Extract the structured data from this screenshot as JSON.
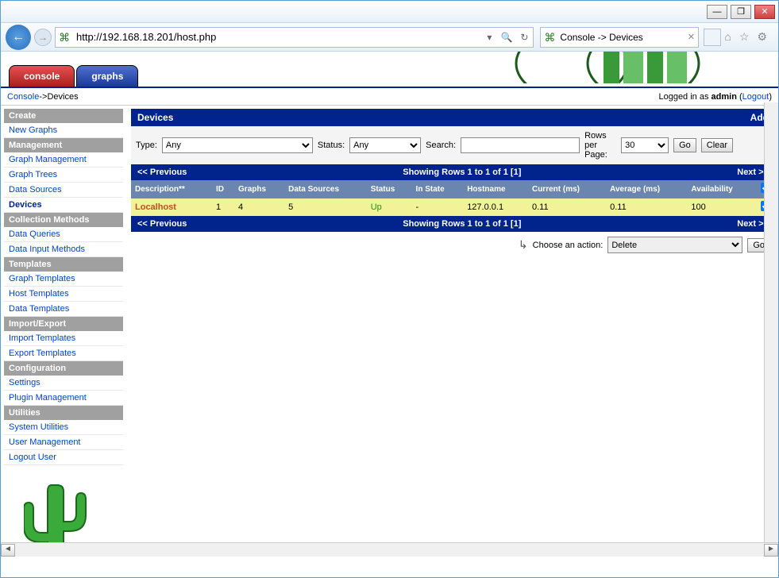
{
  "window": {
    "minimize": "—",
    "maximize": "❐",
    "close": "✕"
  },
  "browser": {
    "url": "http://192.168.18.201/host.php",
    "tab_title": "Console -> Devices",
    "search": "🔍",
    "refresh": "↻",
    "dropdown": "▾",
    "home": "⌂",
    "star": "☆",
    "gear": "⚙"
  },
  "tabs": {
    "console": "console",
    "graphs": "graphs"
  },
  "breadcrumb": {
    "console": "Console",
    "sep": " -> ",
    "page": "Devices",
    "logged": "Logged in as ",
    "user": "admin",
    "logout": "Logout"
  },
  "sidebar": {
    "sections": [
      {
        "title": "Create",
        "items": [
          "New Graphs"
        ]
      },
      {
        "title": "Management",
        "items": [
          "Graph Management",
          "Graph Trees",
          "Data Sources",
          "Devices"
        ]
      },
      {
        "title": "Collection Methods",
        "items": [
          "Data Queries",
          "Data Input Methods"
        ]
      },
      {
        "title": "Templates",
        "items": [
          "Graph Templates",
          "Host Templates",
          "Data Templates"
        ]
      },
      {
        "title": "Import/Export",
        "items": [
          "Import Templates",
          "Export Templates"
        ]
      },
      {
        "title": "Configuration",
        "items": [
          "Settings",
          "Plugin Management"
        ]
      },
      {
        "title": "Utilities",
        "items": [
          "System Utilities",
          "User Management",
          "Logout User"
        ]
      }
    ],
    "active": "Devices"
  },
  "main": {
    "title": "Devices",
    "add": "Add",
    "filter": {
      "type_label": "Type:",
      "type_val": "Any",
      "status_label": "Status:",
      "status_val": "Any",
      "search_label": "Search:",
      "search_val": "",
      "rows_label": "Rows per Page:",
      "rows_val": "30",
      "go": "Go",
      "clear": "Clear"
    },
    "pager": {
      "prev": "<< Previous",
      "mid": "Showing Rows 1 to 1 of 1 [1]",
      "next": "Next >>"
    },
    "cols": {
      "desc": "Description**",
      "id": "ID",
      "graphs": "Graphs",
      "ds": "Data Sources",
      "status": "Status",
      "instate": "In State",
      "hostname": "Hostname",
      "cur": "Current (ms)",
      "avg": "Average (ms)",
      "avail": "Availability"
    },
    "rows": [
      {
        "desc": "Localhost",
        "id": "1",
        "graphs": "4",
        "ds": "5",
        "status": "Up",
        "instate": "-",
        "hostname": "127.0.0.1",
        "cur": "0.11",
        "avg": "0.11",
        "avail": "100"
      }
    ],
    "action": {
      "label": "Choose an action:",
      "sel": "Delete",
      "go": "Go"
    }
  }
}
